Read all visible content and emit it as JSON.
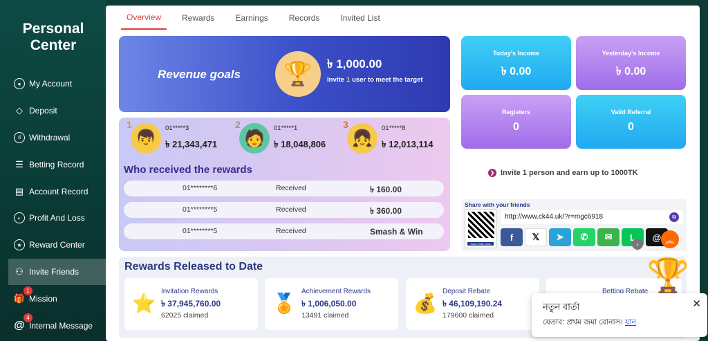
{
  "sidebar": {
    "title": "Personal Center",
    "items": [
      {
        "label": "My Account",
        "icon": "account-icon"
      },
      {
        "label": "Deposit",
        "icon": "deposit-icon"
      },
      {
        "label": "Withdrawal",
        "icon": "withdrawal-icon"
      },
      {
        "label": "Betting Record",
        "icon": "betting-record-icon"
      },
      {
        "label": "Account Record",
        "icon": "account-record-icon"
      },
      {
        "label": "Profit And Loss",
        "icon": "profit-loss-icon"
      },
      {
        "label": "Reward Center",
        "icon": "reward-center-icon"
      },
      {
        "label": "Invite Friends",
        "icon": "invite-friends-icon",
        "active": true
      },
      {
        "label": "Mission",
        "icon": "mission-icon",
        "badge": "1"
      },
      {
        "label": "Internal Message",
        "icon": "message-icon",
        "badge": "4"
      }
    ]
  },
  "tabs": [
    "Overview",
    "Rewards",
    "Earnings",
    "Records",
    "Invited List"
  ],
  "active_tab": "Overview",
  "revenue": {
    "label": "Revenue goals",
    "amount": "৳ 1,000.00",
    "invite_prefix": "Invite",
    "invite_count": "1",
    "invite_suffix": "user to meet the target"
  },
  "top3": [
    {
      "rank": "1",
      "phone": "01*****3",
      "amount": "৳ 21,343,471"
    },
    {
      "rank": "2",
      "phone": "01*****1",
      "amount": "৳ 18,048,806"
    },
    {
      "rank": "3",
      "phone": "01*****8",
      "amount": "৳ 12,013,114"
    }
  ],
  "who_title": "Who received the rewards",
  "reward_rows": [
    {
      "phone": "01********6",
      "status": "Received",
      "amount": "৳  160.00"
    },
    {
      "phone": "01********5",
      "status": "Received",
      "amount": "৳  360.00"
    },
    {
      "phone": "01********5",
      "status": "Received",
      "amount": "Smash & Win"
    }
  ],
  "stats": [
    {
      "label": "Today's Income",
      "value": "৳ 0.00"
    },
    {
      "label": "Yesterday's Income",
      "value": "৳ 0.00"
    },
    {
      "label": "Registers",
      "value": "0"
    },
    {
      "label": "Valid Referral",
      "value": "0"
    }
  ],
  "invite_note": "Invite 1 person and earn up to 1000TK",
  "share": {
    "title": "Share with your friends",
    "url": "http://www.ck44.uk/?r=mgc6918",
    "qr_caption": "Save invite code",
    "buttons": [
      {
        "name": "facebook",
        "glyph": "f",
        "color": "#3b5998"
      },
      {
        "name": "x",
        "glyph": "𝕏",
        "color": "#111111"
      },
      {
        "name": "telegram",
        "glyph": "➤",
        "color": "#2aa3d9"
      },
      {
        "name": "whatsapp",
        "glyph": "✆",
        "color": "#25d366"
      },
      {
        "name": "sms",
        "glyph": "✉",
        "color": "#3cb44b"
      },
      {
        "name": "line",
        "glyph": "L",
        "color": "#06c755"
      },
      {
        "name": "threads",
        "glyph": "@",
        "color": "#111111"
      }
    ]
  },
  "released": {
    "title": "Rewards Released to Date",
    "cards": [
      {
        "title": "Invitation Rewards",
        "value": "৳  37,945,760.00",
        "claimed": "62025 claimed",
        "icon": "star-icon"
      },
      {
        "title": "Achievement Rewards",
        "value": "৳  1,006,050.00",
        "claimed": "13491 claimed",
        "icon": "medal-icon"
      },
      {
        "title": "Deposit Rebate",
        "value": "৳  46,109,190.24",
        "claimed": "179600 claimed",
        "icon": "coins-icon"
      },
      {
        "title": "Betting Rebate",
        "value": "",
        "claimed": "",
        "icon": "betting-icon"
      }
    ]
  },
  "toast": {
    "title": "নতুন বার্তা",
    "body": "যেতাব: প্রথম জমা বোনাস।",
    "link": "যান"
  },
  "colors": {
    "accent": "#e53935",
    "sidebar": "#0e4a44"
  }
}
